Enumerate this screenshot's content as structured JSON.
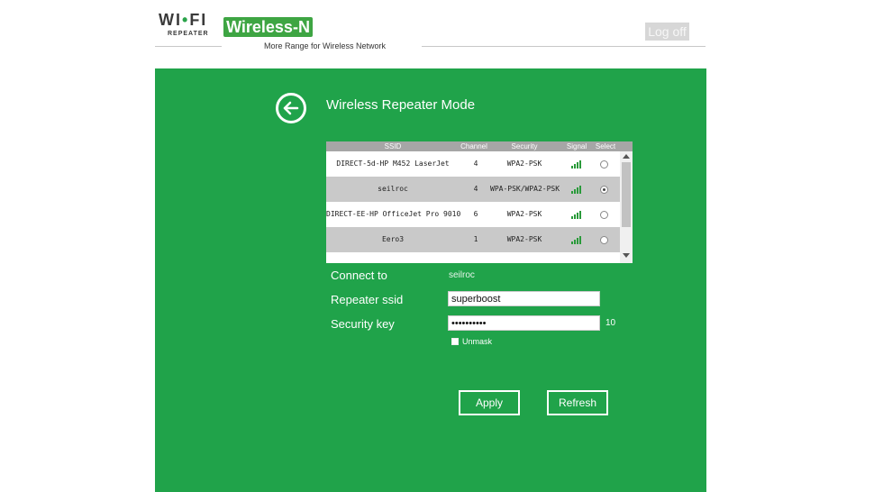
{
  "header": {
    "logo_text_left": "WI",
    "logo_text_right": "FI",
    "logo_sub": "REPEATER",
    "brand": "Wireless-N",
    "tagline": "More Range for Wireless Network",
    "logoff_label": "Log off"
  },
  "page": {
    "title": "Wireless Repeater Mode"
  },
  "table": {
    "columns": [
      "SSID",
      "Channel",
      "Security",
      "Signal",
      "Select"
    ],
    "rows": [
      {
        "ssid": "DIRECT-5d-HP M452 LaserJet",
        "channel": "4",
        "security": "WPA2-PSK",
        "signal_bars": 4,
        "selected": false
      },
      {
        "ssid": "seilroc",
        "channel": "4",
        "security": "WPA-PSK/WPA2-PSK",
        "signal_bars": 4,
        "selected": true
      },
      {
        "ssid": "DIRECT-EE-HP OfficeJet Pro 9010",
        "channel": "6",
        "security": "WPA2-PSK",
        "signal_bars": 4,
        "selected": false
      },
      {
        "ssid": "Eero3",
        "channel": "1",
        "security": "WPA2-PSK",
        "signal_bars": 4,
        "selected": false
      }
    ]
  },
  "form": {
    "connect_label": "Connect to",
    "connect_value": "seilroc",
    "ssid_label": "Repeater ssid",
    "ssid_value": "superboost",
    "key_label": "Security key",
    "key_value": "••••••••••",
    "key_count": "10",
    "unmask_label": "Unmask",
    "unmask_checked": false,
    "apply_label": "Apply",
    "refresh_label": "Refresh"
  },
  "colors": {
    "panel_green": "#20a34a",
    "brand_green": "#3ea543",
    "signal_green": "#2a9a3a"
  }
}
